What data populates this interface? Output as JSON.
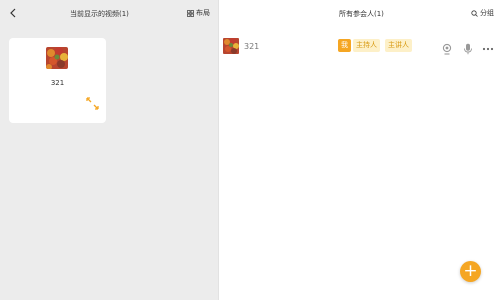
{
  "left_panel": {
    "title": "当前显示的视频(1)",
    "layout_label": "布局",
    "tile": {
      "name": "321"
    }
  },
  "right_panel": {
    "title": "所有参会人(1)",
    "group_label": "分组",
    "participants": [
      {
        "name": "321",
        "badges": [
          "我",
          "主持人",
          "主讲人"
        ]
      }
    ]
  },
  "fab": {
    "label": "+"
  },
  "colors": {
    "accent": "#f5a623",
    "badge_bg": "#fdf0c8",
    "left_bg": "#ececec"
  },
  "icons": [
    "back-icon",
    "layout-grid-icon",
    "expand-icon",
    "search-group-icon",
    "camera-icon",
    "microphone-icon",
    "more-icon",
    "add-icon"
  ]
}
